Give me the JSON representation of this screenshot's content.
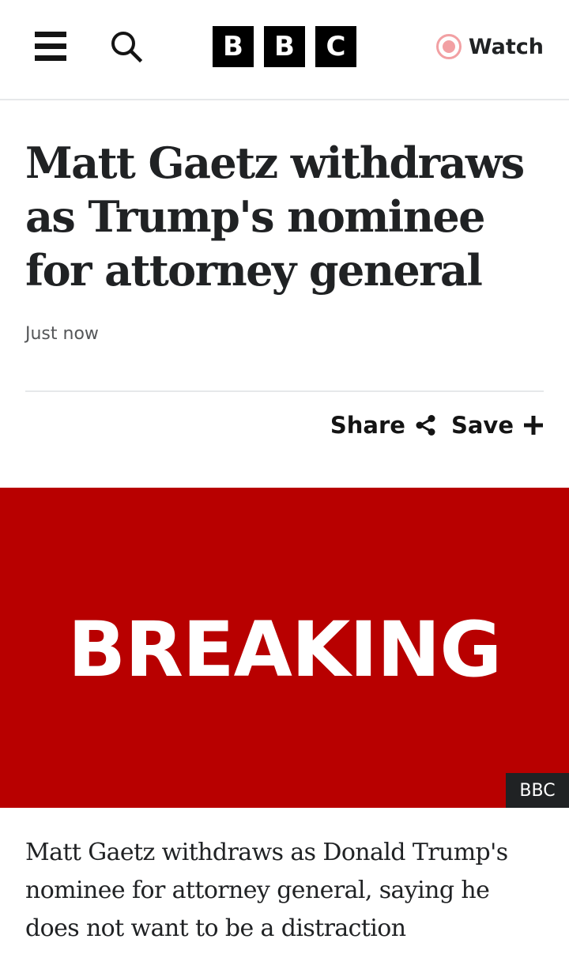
{
  "header": {
    "menu_icon": "menu-icon",
    "search_icon": "search-icon",
    "logo_letters": [
      "B",
      "B",
      "C"
    ],
    "watch_label": "Watch",
    "watch_icon": "live-dot-icon",
    "watch_color": "#f2a0a3"
  },
  "article": {
    "headline": "Matt Gaetz withdraws as Trump's nominee for attorney general",
    "timestamp": "Just now",
    "share_label": "Share",
    "share_icon": "share-icon",
    "save_label": "Save",
    "save_icon": "plus-icon",
    "image": {
      "text": "BREAKING",
      "background": "#b80000",
      "credit": "BBC"
    },
    "summary": "Matt Gaetz withdraws as Donald Trump's nominee for attorney general, saying he does not want to be a distraction"
  }
}
